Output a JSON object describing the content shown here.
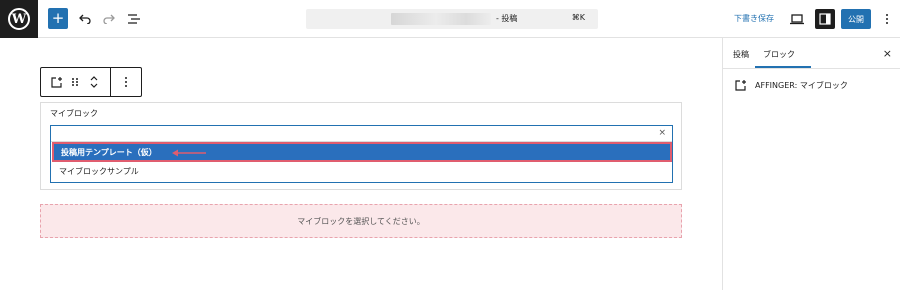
{
  "toolbar": {
    "add_label": "+",
    "logo_letter": "W",
    "command_title": "- 投稿",
    "command_shortcut": "⌘K",
    "save_draft_label": "下書き保存",
    "publish_label": "公開"
  },
  "block": {
    "label": "マイブロック",
    "selected_option": "投稿用テンプレート（仮）",
    "options": [
      "投稿用テンプレート（仮）",
      "マイブロックサンプル"
    ],
    "clear_label": "×",
    "placeholder": "マイブロックを選択してください。"
  },
  "sidebar": {
    "tabs": [
      "投稿",
      "ブロック"
    ],
    "active_tab": "ブロック",
    "close_label": "×",
    "block_name": "AFFINGER: マイブロック"
  },
  "colors": {
    "accent": "#2271b1",
    "highlight_border": "#e05d6f",
    "placeholder_bg": "#fbe8ea",
    "dark": "#1e1e1e"
  }
}
